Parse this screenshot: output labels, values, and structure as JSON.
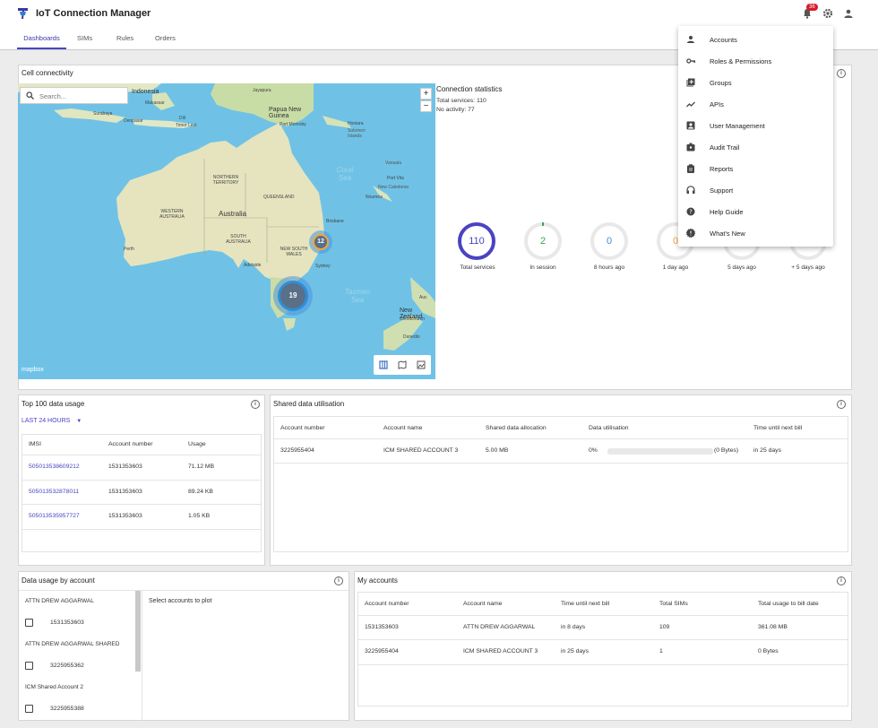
{
  "header": {
    "title": "IoT Connection Manager",
    "notification_count": "36",
    "tabs": [
      {
        "label": "Dashboards"
      },
      {
        "label": "SIMs"
      },
      {
        "label": "Rules"
      },
      {
        "label": "Orders"
      }
    ]
  },
  "cell_connectivity": {
    "title": "Cell connectivity",
    "search_placeholder": "Search...",
    "zoom_in": "+",
    "zoom_out": "−",
    "attribution": "mapbox",
    "map_labels": {
      "indonesia": "Indonesia",
      "jayapura": "Jayapura",
      "makassar": "Makassar",
      "papua_new_guinea": "Papua New Guinea",
      "port_moresby": "Port Moresby",
      "surabaya": "Surabaya",
      "denpasar": "Denpasar",
      "timor_lest": "Timor Lest",
      "dili": "Dili",
      "honiara": "Honiara",
      "solomon_islands": "Solomon Islands",
      "vanuatu": "Vanuatu",
      "port_vila": "Port Vila",
      "new_caledonia": "New Caledonia",
      "noumea": "Nouméa",
      "coral_sea": "Coral Sea",
      "northern_territory": "NORTHERN TERRITORY",
      "queensland": "QUEENSLAND",
      "western_australia": "WESTERN AUSTRALIA",
      "australia": "Australia",
      "south_australia": "SOUTH AUSTRALIA",
      "new_south_wales": "NEW SOUTH WALES",
      "perth": "Perth",
      "brisbane": "Brisbane",
      "sydney": "Sydney",
      "adelaide": "Adelaide",
      "tasman_sea": "Tasman Sea",
      "new_zealand": "New Zealand",
      "christchurch": "Christchurch",
      "auckland": "Auckland",
      "dunedin": "Dunedin",
      "auc": "Auc"
    },
    "clusters": [
      {
        "count": "12"
      },
      {
        "count": "19"
      }
    ]
  },
  "connection_statistics": {
    "title": "Connection statistics",
    "total_services_text": "Total services: 110",
    "no_activity_text": "No activity: 77",
    "rings": [
      {
        "value": "110",
        "label": "Total services",
        "color": "#4a43c1"
      },
      {
        "value": "2",
        "label": "In session",
        "color": "#3aa657"
      },
      {
        "value": "0",
        "label": "8 hours ago",
        "color": "#3f8ed6"
      },
      {
        "value": "0",
        "label": "1 day ago",
        "color": "#f3a53c"
      },
      {
        "value": "",
        "label": "5 days ago",
        "color": "#bbbbbb"
      },
      {
        "value": "",
        "label": "+ 5 days ago",
        "color": "#bbbbbb"
      }
    ]
  },
  "top100": {
    "title": "Top 100 data usage",
    "range": "LAST 24 HOURS",
    "columns": [
      "IMSI",
      "Account number",
      "Usage"
    ],
    "rows": [
      {
        "imsi": "505013538609212",
        "account": "1531353603",
        "usage": "71.12 MB"
      },
      {
        "imsi": "505013532878011",
        "account": "1531353603",
        "usage": "89.24 KB"
      },
      {
        "imsi": "505013535957727",
        "account": "1531353603",
        "usage": "1.05 KB"
      }
    ]
  },
  "shared_data": {
    "title": "Shared data utilisation",
    "columns": [
      "Account number",
      "Account name",
      "Shared data allocation",
      "Data utilisation",
      "Time until next bill"
    ],
    "rows": [
      {
        "account_number": "3225955404",
        "account_name": "ICM SHARED ACCOUNT 3",
        "allocation": "5.00 MB",
        "percent": "0%",
        "bytes": "(0 Bytes)",
        "time": "in 25 days",
        "utilisation_fraction": 0
      }
    ]
  },
  "usage_by_account": {
    "title": "Data usage by account",
    "placeholder": "Select accounts to plot",
    "groups": [
      {
        "name": "ATTN DREW AGGARWAL",
        "account": "1531353603"
      },
      {
        "name": "ATTN DREW AGGARWAL SHARED",
        "account": "3225955362"
      },
      {
        "name": "ICM Shared Account 2",
        "account": "3225955388"
      }
    ]
  },
  "my_accounts": {
    "title": "My accounts",
    "columns": [
      "Account number",
      "Account name",
      "Time until next bill",
      "Total SIMs",
      "Total usage to bill date"
    ],
    "rows": [
      {
        "number": "1531353603",
        "name": "ATTN DREW AGGARWAL",
        "time": "in 8 days",
        "sims": "109",
        "usage": "361.08 MB"
      },
      {
        "number": "3225955404",
        "name": "ICM SHARED ACCOUNT 3",
        "time": "in 25 days",
        "sims": "1",
        "usage": "0 Bytes"
      }
    ]
  },
  "menu": {
    "items": [
      {
        "label": "Accounts",
        "icon": "person-icon"
      },
      {
        "label": "Roles & Permissions",
        "icon": "key-icon"
      },
      {
        "label": "Groups",
        "icon": "add-box-icon"
      },
      {
        "label": "APIs",
        "icon": "trending-icon"
      },
      {
        "label": "User Management",
        "icon": "account-box-icon"
      },
      {
        "label": "Audit Trail",
        "icon": "badge-icon"
      },
      {
        "label": "Reports",
        "icon": "clipboard-icon"
      },
      {
        "label": "Support",
        "icon": "headset-icon"
      },
      {
        "label": "Help Guide",
        "icon": "help-icon"
      },
      {
        "label": "What's New",
        "icon": "new-releases-icon"
      }
    ]
  }
}
